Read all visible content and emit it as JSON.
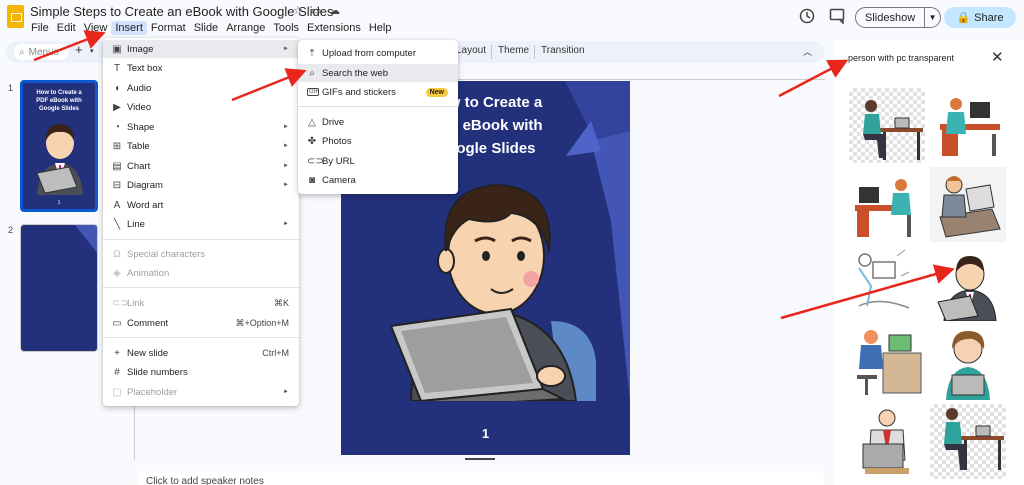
{
  "app": {
    "doc_title": "Simple Steps to Create an eBook with Google Slides"
  },
  "menubar": [
    "File",
    "Edit",
    "View",
    "Insert",
    "Format",
    "Slide",
    "Arrange",
    "Tools",
    "Extensions",
    "Help"
  ],
  "header": {
    "slideshow_label": "Slideshow",
    "share_label": "Share"
  },
  "toolbar": {
    "menus_placeholder": "Menus",
    "layout_label": "Layout",
    "theme_label": "Theme",
    "transition_label": "Transition"
  },
  "filmstrip": {
    "slides": [
      {
        "number": "1",
        "title": "How to Create a\nPDF eBook with\nGoogle Slides",
        "page": "1"
      },
      {
        "number": "2"
      }
    ]
  },
  "slide": {
    "title": "How to Create a\nPDF eBook with\nGoogle Slides",
    "page_number": "1"
  },
  "speaker_notes_placeholder": "Click to add speaker notes",
  "insert_menu": {
    "items": [
      {
        "icon": "image-icon",
        "label": "Image"
      },
      {
        "icon": "text-box-icon",
        "label": "Text box"
      },
      {
        "icon": "audio-icon",
        "label": "Audio"
      },
      {
        "icon": "video-icon",
        "label": "Video"
      },
      {
        "icon": "shape-icon",
        "label": "Shape"
      },
      {
        "icon": "table-icon",
        "label": "Table"
      },
      {
        "icon": "chart-icon",
        "label": "Chart"
      },
      {
        "icon": "diagram-icon",
        "label": "Diagram"
      },
      {
        "icon": "word-art-icon",
        "label": "Word art"
      },
      {
        "icon": "line-icon",
        "label": "Line"
      },
      {
        "icon": "special-characters-icon",
        "label": "Special characters"
      },
      {
        "icon": "animation-icon",
        "label": "Animation"
      },
      {
        "icon": "link-icon",
        "label": "Link",
        "shortcut": "⌘K"
      },
      {
        "icon": "comment-icon",
        "label": "Comment",
        "shortcut": "⌘+Option+M"
      },
      {
        "icon": "new-slide-icon",
        "label": "New slide",
        "shortcut": "Ctrl+M"
      },
      {
        "icon": "slide-numbers-icon",
        "label": "Slide numbers"
      },
      {
        "icon": "placeholder-icon",
        "label": "Placeholder"
      }
    ]
  },
  "image_submenu": {
    "items": [
      {
        "icon": "upload-icon",
        "label": "Upload from computer"
      },
      {
        "icon": "search-icon",
        "label": "Search the web"
      },
      {
        "icon": "gif-icon",
        "label": "GIFs and stickers",
        "badge": "New"
      },
      {
        "icon": "drive-icon",
        "label": "Drive"
      },
      {
        "icon": "photos-icon",
        "label": "Photos"
      },
      {
        "icon": "link-icon",
        "label": "By URL"
      },
      {
        "icon": "camera-icon",
        "label": "Camera"
      }
    ]
  },
  "search_panel": {
    "query": "person with pc transparent"
  },
  "colors": {
    "slide_bg": "#23307c",
    "accent": "#0b57d0",
    "arrow": "#e8261b",
    "share_bg": "#c2e7ff"
  }
}
